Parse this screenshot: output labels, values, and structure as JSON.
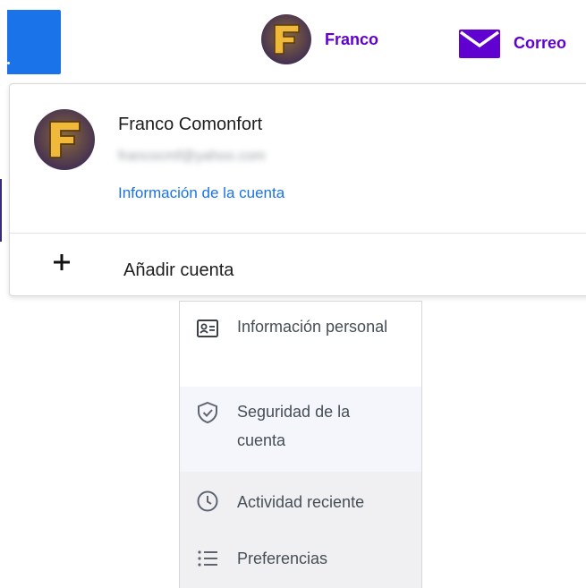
{
  "header": {
    "user_name": "Franco",
    "mail_label": "Correo",
    "brand_color": "#6001d2",
    "button_color": "#1a73e8"
  },
  "account_card": {
    "full_name": "Franco Comonfort",
    "email": "francocmf@yahoo.com",
    "account_info_link": "Información de la cuenta",
    "add_account_label": "Añadir cuenta",
    "avatar_letter": "F"
  },
  "side_menu": {
    "items": [
      {
        "label": "Información personal",
        "icon": "id-card-icon"
      },
      {
        "label": "Seguridad de la cuenta",
        "icon": "shield-icon"
      },
      {
        "label": "Actividad reciente",
        "icon": "clock-icon"
      },
      {
        "label": "Preferencias",
        "icon": "list-icon"
      }
    ]
  },
  "icons": {
    "mail": "mail-icon",
    "plus": "plus-icon",
    "avatar": "avatar-f-icon"
  }
}
